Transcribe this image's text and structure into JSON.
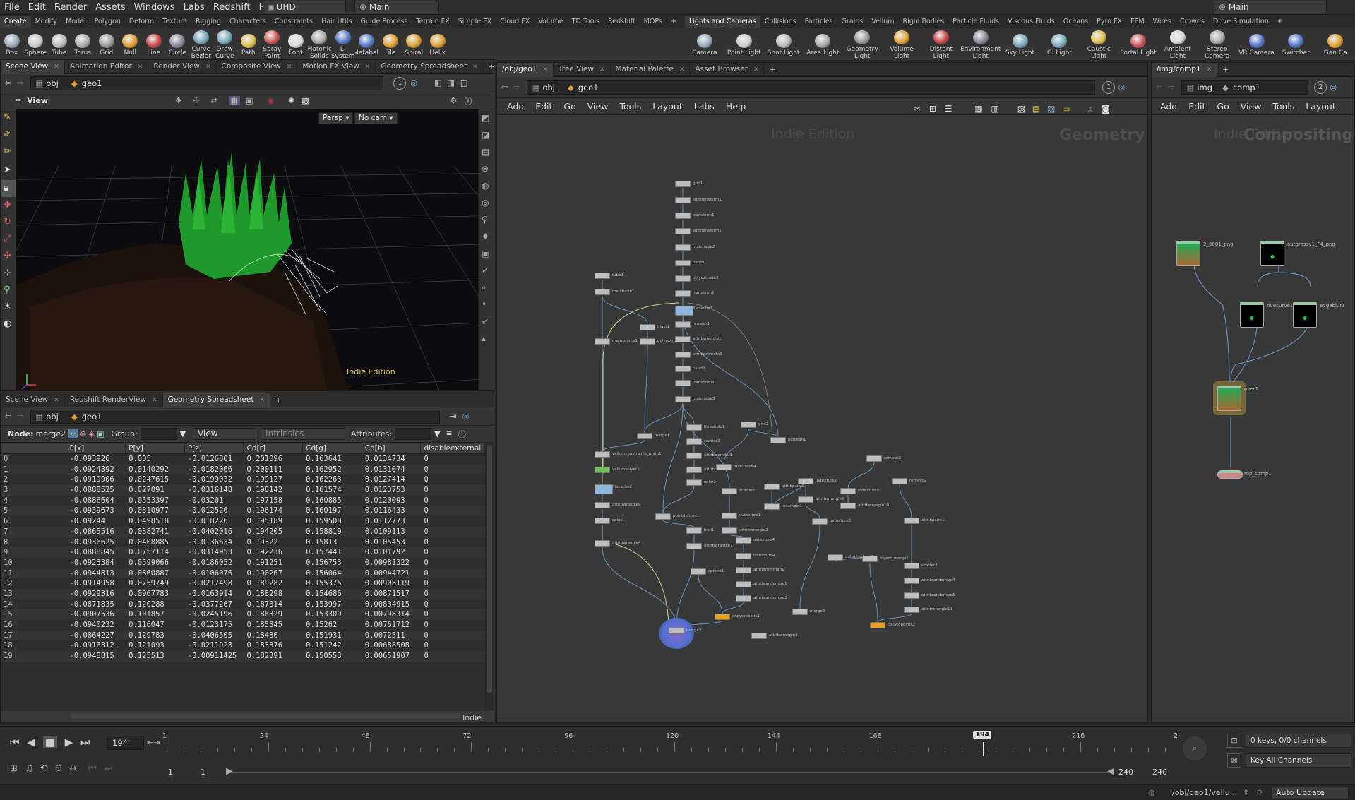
{
  "menubar": {
    "items": [
      "File",
      "Edit",
      "Render",
      "Assets",
      "Windows",
      "Labs",
      "Redshift",
      "Help"
    ],
    "desktop": "UHD",
    "context": "Main",
    "right_context": "Main"
  },
  "shelf": {
    "tabs_left": [
      "Create",
      "Modify",
      "Model",
      "Polygon",
      "Deform",
      "Texture",
      "Rigging",
      "Characters",
      "Constraints",
      "Hair Utils",
      "Guide Process",
      "Terrain FX",
      "Simple FX",
      "Cloud FX",
      "Volume",
      "TD Tools",
      "Redshift",
      "MOPs"
    ],
    "tabs_right": [
      "Lights and Cameras",
      "Collisions",
      "Particles",
      "Grains",
      "Vellum",
      "Rigid Bodies",
      "Particle Fluids",
      "Viscous Fluids",
      "Oceans",
      "Pyro FX",
      "FEM",
      "Wires",
      "Crowds",
      "Drive Simulation"
    ],
    "tools_left": [
      {
        "label": "Box",
        "icon": "box-icon"
      },
      {
        "label": "Sphere",
        "icon": "sphere-icon"
      },
      {
        "label": "Tube",
        "icon": "tube-icon"
      },
      {
        "label": "Torus",
        "icon": "torus-icon"
      },
      {
        "label": "Grid",
        "icon": "grid-icon"
      },
      {
        "label": "Null",
        "icon": "null-icon"
      },
      {
        "label": "Line",
        "icon": "line-icon"
      },
      {
        "label": "Circle",
        "icon": "circle-icon"
      },
      {
        "label": "Curve Bezier",
        "icon": "curve-bezier-icon"
      },
      {
        "label": "Draw Curve",
        "icon": "draw-curve-icon"
      },
      {
        "label": "Path",
        "icon": "path-icon"
      },
      {
        "label": "Spray Paint",
        "icon": "spray-paint-icon"
      },
      {
        "label": "Font",
        "icon": "font-icon"
      },
      {
        "label": "Platonic Solids",
        "icon": "platonic-icon"
      },
      {
        "label": "L-System",
        "icon": "lsystem-icon"
      },
      {
        "label": "Metaball",
        "icon": "metaball-icon"
      },
      {
        "label": "File",
        "icon": "file-icon"
      },
      {
        "label": "Spiral",
        "icon": "spiral-icon"
      },
      {
        "label": "Helix",
        "icon": "helix-icon"
      }
    ],
    "tools_right": [
      {
        "label": "Camera",
        "icon": "camera-icon"
      },
      {
        "label": "Point Light",
        "icon": "point-light-icon"
      },
      {
        "label": "Spot Light",
        "icon": "spot-light-icon"
      },
      {
        "label": "Area Light",
        "icon": "area-light-icon"
      },
      {
        "label": "Geometry Light",
        "icon": "geometry-light-icon"
      },
      {
        "label": "Volume Light",
        "icon": "volume-light-icon"
      },
      {
        "label": "Distant Light",
        "icon": "distant-light-icon"
      },
      {
        "label": "Environment Light",
        "icon": "environment-light-icon"
      },
      {
        "label": "Sky Light",
        "icon": "sky-light-icon"
      },
      {
        "label": "GI Light",
        "icon": "gi-light-icon"
      },
      {
        "label": "Caustic Light",
        "icon": "caustic-light-icon"
      },
      {
        "label": "Portal Light",
        "icon": "portal-light-icon"
      },
      {
        "label": "Ambient Light",
        "icon": "ambient-light-icon"
      },
      {
        "label": "Stereo Camera",
        "icon": "stereo-camera-icon"
      },
      {
        "label": "VR Camera",
        "icon": "vr-camera-icon"
      },
      {
        "label": "Switcher",
        "icon": "switcher-icon"
      },
      {
        "label": "Gan Ca",
        "icon": "gamepad-camera-icon"
      }
    ]
  },
  "scene_panel": {
    "tabs": [
      "Scene View",
      "Animation Editor",
      "Render View",
      "Composite View",
      "Motion FX View",
      "Geometry Spreadsheet"
    ],
    "path_root": "obj",
    "path_node": "geo1",
    "view_label": "View",
    "persp": "Persp",
    "cam": "No cam",
    "edition": "Indie Edition",
    "badge": "1"
  },
  "sheet_panel": {
    "tabs": [
      "Scene View",
      "Redshift RenderView",
      "Geometry Spreadsheet"
    ],
    "path_root": "obj",
    "path_node": "geo1",
    "node_label": "Node:",
    "node_name": "merge2",
    "group_label": "Group:",
    "view_label": "View",
    "intrinsics_label": "Intrinsics",
    "attributes_label": "Attributes:",
    "columns": [
      "",
      "P[x]",
      "P[y]",
      "P[z]",
      "Cd[r]",
      "Cd[g]",
      "Cd[b]",
      "disableexternal"
    ],
    "rows": [
      [
        "0",
        "-0.093926",
        "0.005",
        "-0.0126801",
        "0.201096",
        "0.163641",
        "0.0134734",
        "0"
      ],
      [
        "1",
        "-0.0924392",
        "0.0140292",
        "-0.0182066",
        "0.200111",
        "0.162952",
        "0.0131074",
        "0"
      ],
      [
        "2",
        "-0.0919906",
        "0.0247615",
        "-0.0199032",
        "0.199127",
        "0.162263",
        "0.0127414",
        "0"
      ],
      [
        "3",
        "-0.0888525",
        "0.027091",
        "-0.0316148",
        "0.198142",
        "0.161574",
        "0.0123753",
        "0"
      ],
      [
        "4",
        "-0.0886604",
        "0.0553397",
        "-0.03201",
        "0.197158",
        "0.160885",
        "0.0120093",
        "0"
      ],
      [
        "5",
        "-0.0939673",
        "0.0310977",
        "-0.012526",
        "0.196174",
        "0.160197",
        "0.0116433",
        "0"
      ],
      [
        "6",
        "-0.09244",
        "0.0498518",
        "-0.018226",
        "0.195189",
        "0.159508",
        "0.0112773",
        "0"
      ],
      [
        "7",
        "-0.0865516",
        "0.0382741",
        "-0.0402016",
        "0.194205",
        "0.158819",
        "0.0109113",
        "0"
      ],
      [
        "8",
        "-0.0936625",
        "0.0408885",
        "-0.0136634",
        "0.19322",
        "0.15813",
        "0.0105453",
        "0"
      ],
      [
        "9",
        "-0.0888845",
        "0.0757114",
        "-0.0314953",
        "0.192236",
        "0.157441",
        "0.0101792",
        "0"
      ],
      [
        "10",
        "-0.0923384",
        "0.0599066",
        "-0.0186052",
        "0.191251",
        "0.156753",
        "0.00981322",
        "0"
      ],
      [
        "11",
        "-0.0944813",
        "0.0860887",
        "-0.0106076",
        "0.190267",
        "0.156064",
        "0.00944721",
        "0"
      ],
      [
        "12",
        "-0.0914958",
        "0.0759749",
        "-0.0217498",
        "0.189282",
        "0.155375",
        "0.00908119",
        "0"
      ],
      [
        "13",
        "-0.0929316",
        "0.0967783",
        "-0.0163914",
        "0.188298",
        "0.154686",
        "0.00871517",
        "0"
      ],
      [
        "14",
        "-0.0871835",
        "0.120288",
        "-0.0377267",
        "0.187314",
        "0.153997",
        "0.00834915",
        "0"
      ],
      [
        "15",
        "-0.0907536",
        "0.101857",
        "-0.0245196",
        "0.186329",
        "0.153309",
        "0.00798314",
        "0"
      ],
      [
        "16",
        "-0.0940232",
        "0.116047",
        "-0.0123175",
        "0.185345",
        "0.15262",
        "0.00761712",
        "0"
      ],
      [
        "17",
        "-0.0864227",
        "0.129783",
        "-0.0406505",
        "0.18436",
        "0.151931",
        "0.0072511",
        "0"
      ],
      [
        "18",
        "-0.0916312",
        "0.121093",
        "-0.0211928",
        "0.183376",
        "0.151242",
        "0.00688508",
        "0"
      ],
      [
        "19",
        "-0.0948815",
        "0.125513",
        "-0.00911425",
        "0.182391",
        "0.150553",
        "0.00651907",
        "0"
      ]
    ],
    "indie": "Indie"
  },
  "network_panel": {
    "tabs": [
      "/obj/geo1",
      "Tree View",
      "Material Palette",
      "Asset Browser"
    ],
    "path_root": "obj",
    "path_node": "geo1",
    "menu": [
      "Add",
      "Edit",
      "Go",
      "View",
      "Tools",
      "Layout",
      "Labs",
      "Help"
    ],
    "watermark_edition": "Indie Edition",
    "watermark_context": "Geometry",
    "badge": "1",
    "nodes": [
      {
        "name": "grid1",
        "style": "gray"
      },
      {
        "name": "softtransform1",
        "style": "gray"
      },
      {
        "name": "transform1",
        "style": "gray"
      },
      {
        "name": "softtransform2",
        "style": "gray"
      },
      {
        "name": "matchsize2",
        "style": "gray"
      },
      {
        "name": "bend1",
        "style": "gray"
      },
      {
        "name": "polyextrude2",
        "style": "gray"
      },
      {
        "name": "transform2",
        "style": "gray"
      },
      {
        "name": "filecache1",
        "style": "blue"
      },
      {
        "name": "remesh1",
        "style": "gray"
      },
      {
        "name": "attribwrangle1",
        "style": "gray"
      },
      {
        "name": "attribpromote1",
        "style": "gray"
      },
      {
        "name": "bend2",
        "style": "gray"
      },
      {
        "name": "transform3",
        "style": "gray"
      },
      {
        "name": "matchsize3",
        "style": "gray"
      },
      {
        "name": "tube1",
        "style": "gray"
      },
      {
        "name": "matchsize1",
        "style": "gray"
      },
      {
        "name": "blast1",
        "style": "gray"
      },
      {
        "name": "polyextrude1",
        "style": "gray"
      },
      {
        "name": "grainsource1",
        "style": "gray"
      },
      {
        "name": "merge1",
        "style": "gray"
      },
      {
        "name": "vellumconstraints_grain1",
        "style": "gray"
      },
      {
        "name": "vellumsolver1",
        "style": "green"
      },
      {
        "name": "filecache2",
        "style": "blue"
      },
      {
        "name": "attribwrangle6",
        "style": "gray"
      },
      {
        "name": "color1",
        "style": "gray"
      },
      {
        "name": "attribwrangle4",
        "style": "gray"
      },
      {
        "name": "threshold1",
        "style": "gray"
      },
      {
        "name": "scatter2",
        "style": "gray"
      },
      {
        "name": "attribtransfer1",
        "style": "gray"
      },
      {
        "name": "attribnoise1",
        "style": "gray"
      },
      {
        "name": "color2",
        "style": "gray"
      },
      {
        "name": "pointdeform1",
        "style": "gray"
      },
      {
        "name": "trail1",
        "style": "gray"
      },
      {
        "name": "attribwrangle7",
        "style": "gray"
      },
      {
        "name": "matchsize4",
        "style": "gray"
      },
      {
        "name": "grid2",
        "style": "gray"
      },
      {
        "name": "boolean1",
        "style": "gray"
      },
      {
        "name": "scatter1",
        "style": "gray"
      },
      {
        "name": "uvtexture1",
        "style": "gray"
      },
      {
        "name": "attribwrangle2",
        "style": "gray"
      },
      {
        "name": "uvtexture4",
        "style": "gray"
      },
      {
        "name": "transform4",
        "style": "gray"
      },
      {
        "name": "sphere1",
        "style": "gray"
      },
      {
        "name": "attribfrommap1",
        "style": "gray"
      },
      {
        "name": "attribrandomize1",
        "style": "gray"
      },
      {
        "name": "attribrandomize2",
        "style": "gray"
      },
      {
        "name": "copytopoints1",
        "style": "orange"
      },
      {
        "name": "merge2",
        "style": "gray"
      },
      {
        "name": "attribwrangle3",
        "style": "gray"
      },
      {
        "name": "attribpaint2",
        "style": "gray"
      },
      {
        "name": "resample1",
        "style": "gray"
      },
      {
        "name": "uvtexture2",
        "style": "gray"
      },
      {
        "name": "attribwrangle5",
        "style": "gray"
      },
      {
        "name": "uvtexture3",
        "style": "gray"
      },
      {
        "name": "merge3",
        "style": "gray"
      },
      {
        "name": "remesh3",
        "style": "gray"
      },
      {
        "name": "uvtexture5",
        "style": "gray"
      },
      {
        "name": "attribwrangle10",
        "style": "gray"
      },
      {
        "name": "remesh2",
        "style": "gray"
      },
      {
        "name": "attribpaint1",
        "style": "gray"
      },
      {
        "name": "outputsubnet1",
        "style": "gray"
      },
      {
        "name": "object_merge1",
        "style": "gray"
      },
      {
        "name": "scatter3",
        "style": "gray"
      },
      {
        "name": "attribrandomize4",
        "style": "gray"
      },
      {
        "name": "attribrandomize5",
        "style": "gray"
      },
      {
        "name": "attribwrangle11",
        "style": "gray"
      },
      {
        "name": "copytopoints2",
        "style": "orange"
      }
    ]
  },
  "comp_panel": {
    "tabs": [
      "/img/comp1"
    ],
    "path_root": "img",
    "path_node": "comp1",
    "menu": [
      "Add",
      "Edit",
      "Go",
      "View",
      "Tools",
      "Layout"
    ],
    "watermark_edition": "Indie Edition",
    "watermark_context": "Compositing",
    "badge": "2",
    "nodes": [
      "2_0001_png",
      "outgrassv1_F4_png",
      "huecurve1",
      "edgeblur1",
      "over1",
      "rop_comp1"
    ]
  },
  "timeline": {
    "frame": "194",
    "ticks": [
      "1",
      "24",
      "48",
      "72",
      "96",
      "120",
      "144",
      "168",
      "194",
      "216",
      "2"
    ],
    "start": "1",
    "start2": "1",
    "end": "240",
    "end2": "240",
    "keys_status": "0 keys, 0/0 channels",
    "key_all": "Key All Channels",
    "status_path": "/obj/geo1/vellu...",
    "auto_update": "Auto Update"
  }
}
